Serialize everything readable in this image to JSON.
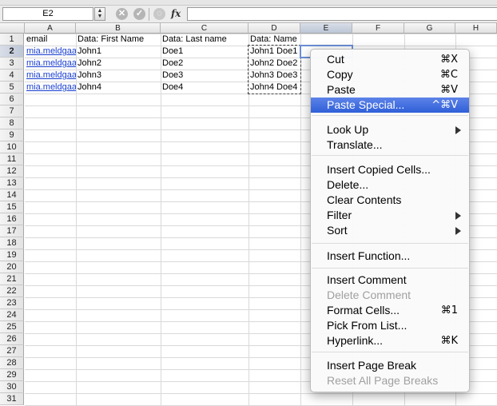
{
  "formula_bar": {
    "name_box": "E2",
    "fx": "fx",
    "formula": ""
  },
  "columns": [
    "A",
    "B",
    "C",
    "D",
    "E",
    "F",
    "G",
    "H"
  ],
  "selected_column": "E",
  "rows": [
    "1",
    "2",
    "3",
    "4",
    "5",
    "6",
    "7",
    "8",
    "9",
    "10",
    "11",
    "12",
    "13",
    "14",
    "15",
    "16",
    "17",
    "18",
    "19",
    "20",
    "21",
    "22",
    "23",
    "24",
    "25",
    "26",
    "27",
    "28",
    "29",
    "30",
    "31"
  ],
  "cells": {
    "A1": "email",
    "B1": "Data: First Name",
    "C1": "Data: Last name",
    "D1": "Data: Name",
    "A2": "mia.meldgaa",
    "B2": "John1",
    "C2": "Doe1",
    "D2": "John1  Doe1",
    "A3": "mia.meldgaa",
    "B3": "John2",
    "C3": "Doe2",
    "D3": "John2 Doe2",
    "A4": "mia.meldgaa",
    "B4": "John3",
    "C4": "Doe3",
    "D4": "John3 Doe3",
    "A5": "mia.meldgaa",
    "B5": "John4",
    "C5": "Doe4",
    "D5": "John4 Doe4"
  },
  "context_menu": {
    "cut": {
      "label": "Cut",
      "shortcut": "⌘X"
    },
    "copy": {
      "label": "Copy",
      "shortcut": "⌘C"
    },
    "paste": {
      "label": "Paste",
      "shortcut": "⌘V"
    },
    "paste_special": {
      "label": "Paste Special...",
      "shortcut": "^⌘V"
    },
    "look_up": {
      "label": "Look Up"
    },
    "translate": {
      "label": "Translate..."
    },
    "insert_copied_cells": {
      "label": "Insert Copied Cells..."
    },
    "delete": {
      "label": "Delete..."
    },
    "clear_contents": {
      "label": "Clear Contents"
    },
    "filter": {
      "label": "Filter"
    },
    "sort": {
      "label": "Sort"
    },
    "insert_function": {
      "label": "Insert Function..."
    },
    "insert_comment": {
      "label": "Insert Comment"
    },
    "delete_comment": {
      "label": "Delete Comment"
    },
    "format_cells": {
      "label": "Format Cells...",
      "shortcut": "⌘1"
    },
    "pick_from_list": {
      "label": "Pick From List..."
    },
    "hyperlink": {
      "label": "Hyperlink...",
      "shortcut": "⌘K"
    },
    "insert_page_break": {
      "label": "Insert Page Break"
    },
    "reset_all_page_breaks": {
      "label": "Reset All Page Breaks"
    }
  }
}
